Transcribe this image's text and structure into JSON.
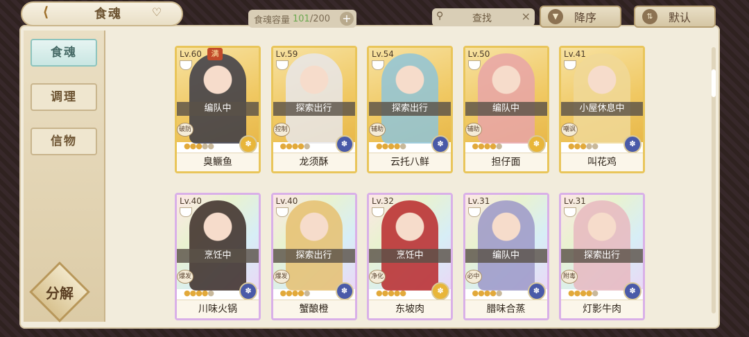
{
  "header": {
    "title": "食魂",
    "back_icon": "back-chevron-icon",
    "capacity_label": "食魂容量",
    "capacity_current": "101",
    "capacity_total": "/200",
    "search_label": "查找",
    "sort_label": "降序",
    "default_label": "默认"
  },
  "sidebar": {
    "items": [
      {
        "label": "食魂",
        "active": true
      },
      {
        "label": "调理",
        "active": false
      },
      {
        "label": "信物",
        "active": false
      }
    ],
    "decompose_label": "分解"
  },
  "full_badge": "满",
  "cards": [
    {
      "level": "Lv.60",
      "status": "编队中",
      "role": "破防",
      "name": "臭鳜鱼",
      "stars": 3,
      "element": "gold",
      "style": "gold"
    },
    {
      "level": "Lv.59",
      "status": "探索出行",
      "role": "控制",
      "name": "龙须酥",
      "stars": 4,
      "element": "blue",
      "style": "gold"
    },
    {
      "level": "Lv.54",
      "status": "探索出行",
      "role": "辅助",
      "name": "云托八鲜",
      "stars": 4,
      "element": "blue",
      "style": "gold"
    },
    {
      "level": "Lv.50",
      "status": "编队中",
      "role": "辅助",
      "name": "担仔面",
      "stars": 4,
      "element": "gold",
      "style": "gold"
    },
    {
      "level": "Lv.41",
      "status": "小屋休息中",
      "role": "嘲讽",
      "name": "叫花鸡",
      "stars": 3,
      "element": "blue",
      "style": "gold"
    },
    {
      "level": "Lv.40",
      "status": "烹饪中",
      "role": "爆发",
      "name": "川味火锅",
      "stars": 4,
      "element": "blue",
      "style": "rainbow"
    },
    {
      "level": "Lv.40",
      "status": "探索出行",
      "role": "爆发",
      "name": "蟹酿橙",
      "stars": 4,
      "element": "blue",
      "style": "rainbow"
    },
    {
      "level": "Lv.32",
      "status": "烹饪中",
      "role": "净化",
      "name": "东坡肉",
      "stars": 5,
      "element": "gold",
      "style": "rainbow"
    },
    {
      "level": "Lv.31",
      "status": "编队中",
      "role": "必中",
      "name": "腊味合蒸",
      "stars": 4,
      "element": "blue",
      "style": "rainbow"
    },
    {
      "level": "Lv.31",
      "status": "探索出行",
      "role": "附毒",
      "name": "灯影牛肉",
      "stars": 4,
      "element": "blue",
      "style": "rainbow"
    }
  ]
}
